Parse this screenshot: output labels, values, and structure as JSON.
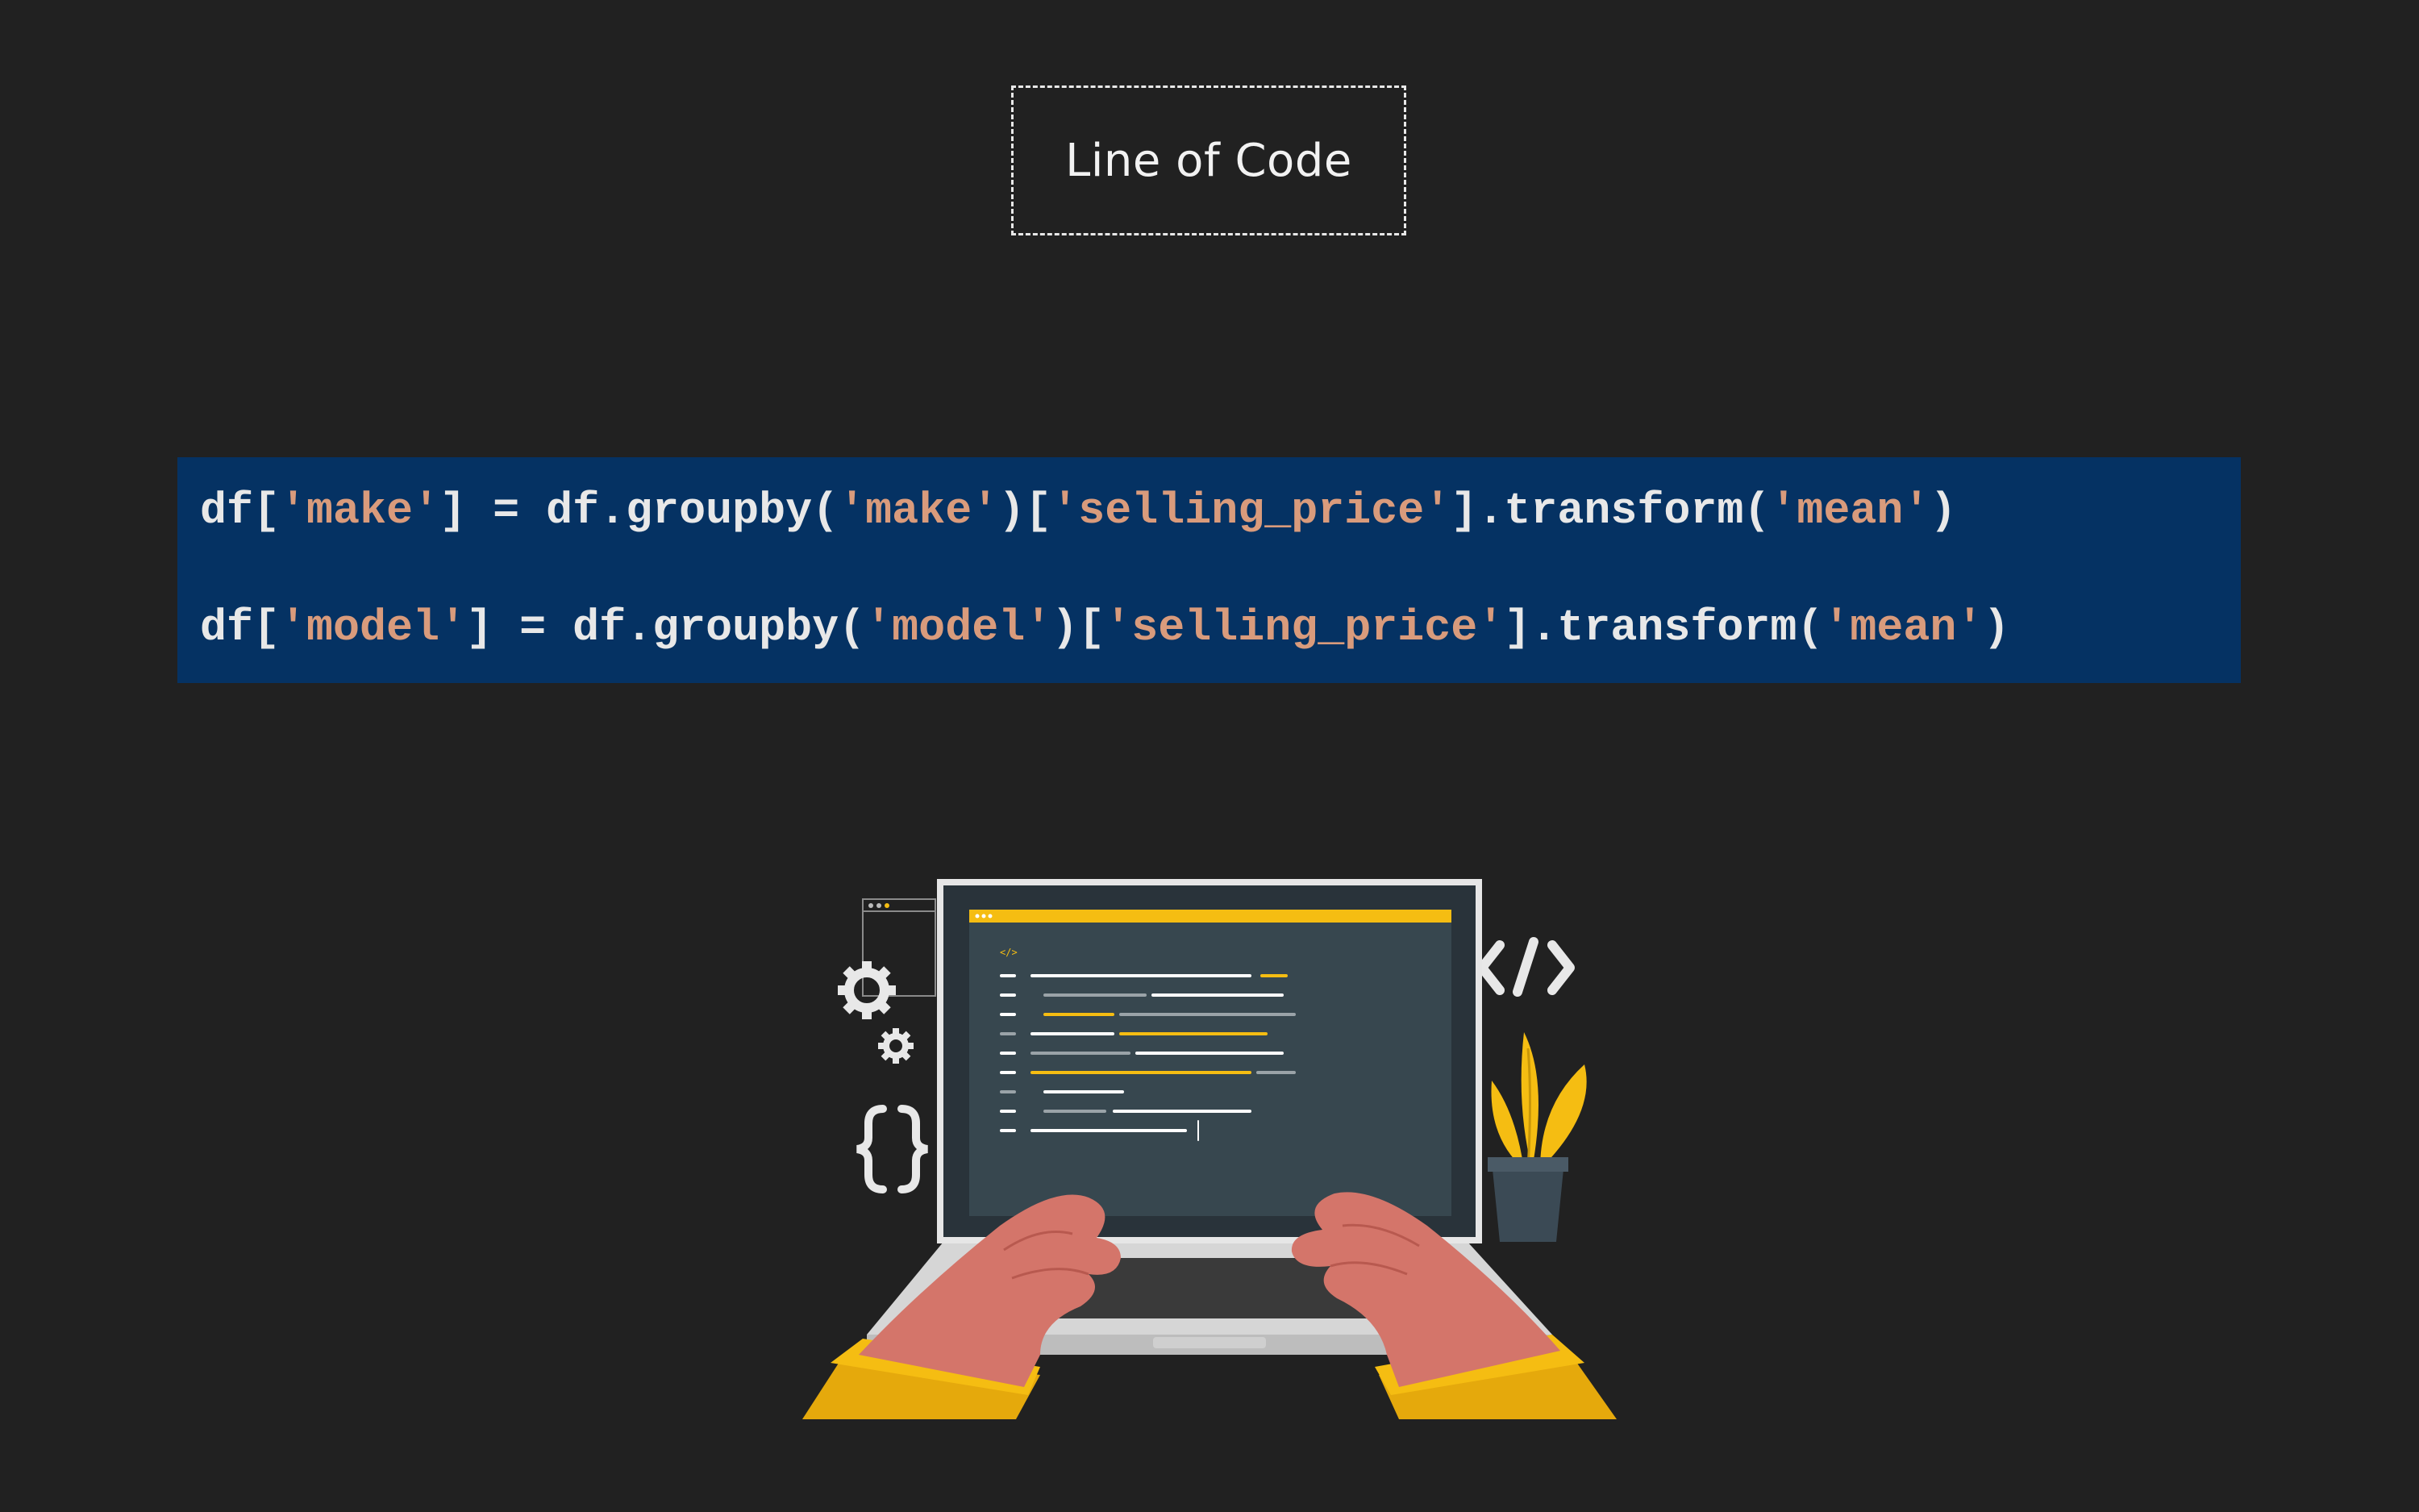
{
  "title": "Line of Code",
  "code": {
    "lines": [
      {
        "tokens": [
          {
            "t": "df[",
            "k": "plain"
          },
          {
            "t": "'make'",
            "k": "str"
          },
          {
            "t": "] = df.groupby(",
            "k": "plain"
          },
          {
            "t": "'make'",
            "k": "str"
          },
          {
            "t": ")[",
            "k": "plain"
          },
          {
            "t": "'selling_price'",
            "k": "str"
          },
          {
            "t": "].transform(",
            "k": "plain"
          },
          {
            "t": "'mean'",
            "k": "str"
          },
          {
            "t": ")",
            "k": "plain"
          }
        ]
      },
      {
        "tokens": [
          {
            "t": "df[",
            "k": "plain"
          },
          {
            "t": "'model'",
            "k": "str"
          },
          {
            "t": "] = df.groupby(",
            "k": "plain"
          },
          {
            "t": "'model'",
            "k": "str"
          },
          {
            "t": ")[",
            "k": "plain"
          },
          {
            "t": "'selling_price'",
            "k": "str"
          },
          {
            "t": "].transform(",
            "k": "plain"
          },
          {
            "t": "'mean'",
            "k": "str"
          },
          {
            "t": ")",
            "k": "plain"
          }
        ]
      }
    ]
  },
  "colors": {
    "background": "#212121",
    "code_panel": "#053263",
    "string_token": "#d99b7c",
    "plain_token": "#e8e8e8",
    "accent_yellow": "#f5bd12",
    "skin": "#d4756a"
  },
  "illustration": {
    "icons": [
      "gear-icon",
      "small-gear-icon",
      "curly-braces-icon",
      "code-tag-icon",
      "plant-icon",
      "laptop-icon"
    ]
  }
}
